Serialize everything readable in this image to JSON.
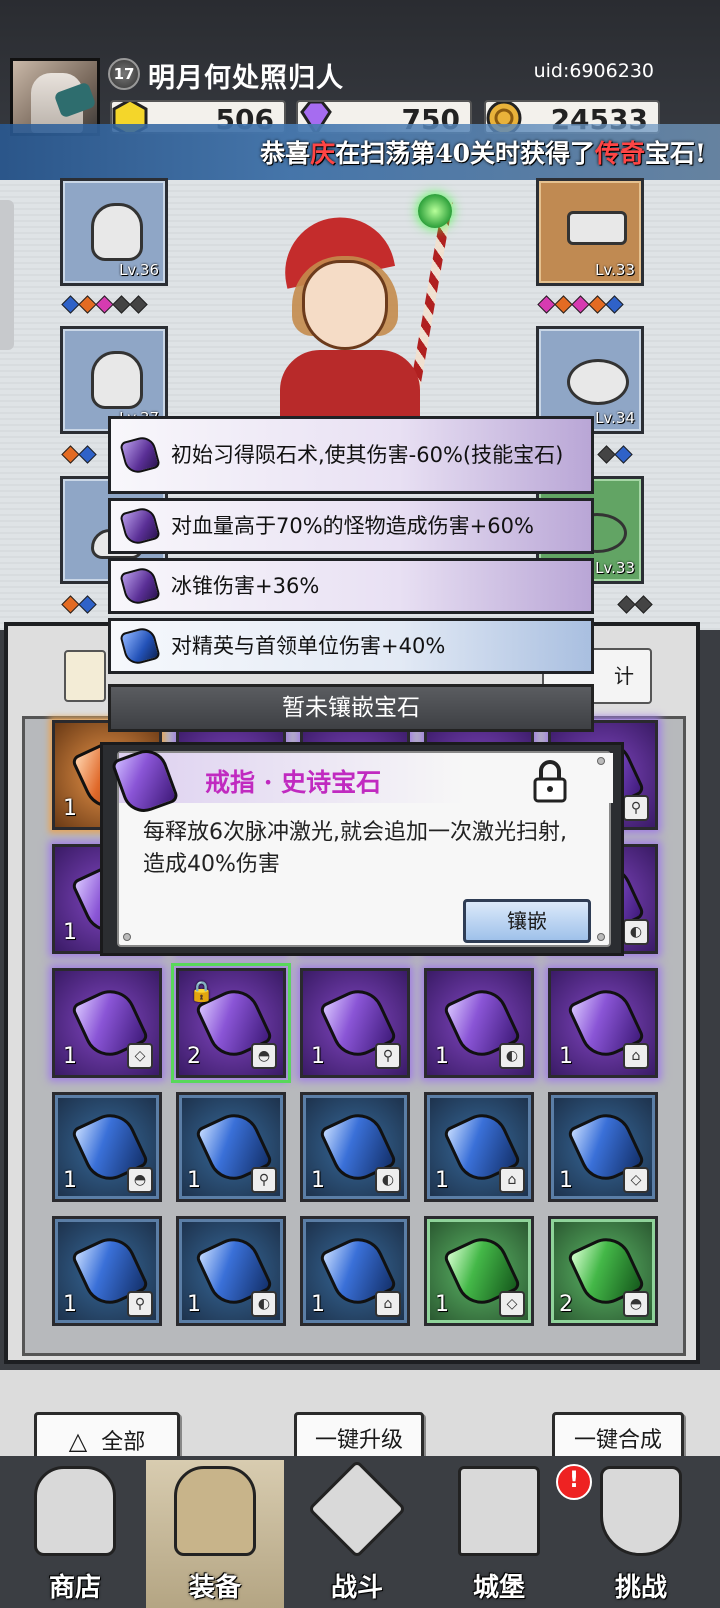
{
  "player": {
    "level": "17",
    "name": "明月何处照归人",
    "uid": "uid:6906230"
  },
  "currency": {
    "gold_gem": "506",
    "purple_gem": "750",
    "coin": "24533"
  },
  "banner": {
    "prefix": "恭喜",
    "player": "庆",
    "middle": "在扫荡第40关时获得了",
    "rarity": "传奇",
    "suffix": "宝石!"
  },
  "equipment": {
    "slot_helmet_lv": "Lv.36",
    "slot_armor_lv": "Lv.37",
    "slot_weapon_lv": "Lv.33",
    "slot_ring_lv": "Lv.34",
    "slot_boot_lv": "Lv.33"
  },
  "skills": [
    {
      "text": "初始习得陨石术,使其伤害-60%(技能宝石)",
      "gem": "purple-gem-icon"
    },
    {
      "text": "对血量高于70%的怪物造成伤害+60%",
      "gem": "purple-gem-icon"
    },
    {
      "text": "冰锥伤害+36%",
      "gem": "purple-gem-icon"
    },
    {
      "text": "对精英与首领单位伤害+40%",
      "gem": "blue-gem-icon"
    }
  ],
  "no_gem_text": "暂未镶嵌宝石",
  "inventory": {
    "tab_right_label": "计",
    "rows": [
      [
        {
          "color": "orange",
          "count": "1"
        },
        {
          "color": "purple",
          "count": ""
        },
        {
          "color": "purple",
          "count": ""
        },
        {
          "color": "purple",
          "count": ""
        },
        {
          "color": "purple",
          "count": ""
        }
      ],
      [
        {
          "color": "purple",
          "count": "1"
        },
        {
          "color": "purple",
          "count": ""
        },
        {
          "color": "purple",
          "count": ""
        },
        {
          "color": "purple",
          "count": ""
        },
        {
          "color": "purple",
          "count": ""
        }
      ],
      [
        {
          "color": "purple",
          "count": "1"
        },
        {
          "color": "purple",
          "count": "2"
        },
        {
          "color": "purple",
          "count": "1"
        },
        {
          "color": "purple",
          "count": "1"
        },
        {
          "color": "purple",
          "count": "1"
        }
      ],
      [
        {
          "color": "blue",
          "count": "1"
        },
        {
          "color": "blue",
          "count": "1"
        },
        {
          "color": "blue",
          "count": "1"
        },
        {
          "color": "blue",
          "count": "1"
        },
        {
          "color": "blue",
          "count": "1"
        }
      ],
      [
        {
          "color": "blue",
          "count": "1"
        },
        {
          "color": "blue",
          "count": "1"
        },
        {
          "color": "blue",
          "count": "1"
        },
        {
          "color": "green",
          "count": "1"
        },
        {
          "color": "green",
          "count": "2"
        }
      ]
    ]
  },
  "detail": {
    "gem_name": "戒指 · 史诗宝石",
    "description": "每释放6次脉冲激光,就会追加一次激光扫射,造成40%伤害",
    "inlay_button": "镶嵌"
  },
  "actions": {
    "all": "全部",
    "upgrade_all": "一键升级",
    "merge_all": "一键合成"
  },
  "nav": {
    "shop": "商店",
    "equipment": "装备",
    "battle": "战斗",
    "castle": "城堡",
    "challenge": "挑战",
    "castle_badge": "!"
  },
  "colors": {
    "purple_gem": "#8a55d6",
    "blue_gem": "#3a70d8",
    "green_gem": "#44b848",
    "orange_gem": "#e0692a",
    "rarity_red": "#ff4545",
    "epic_title": "#c02ac0"
  }
}
